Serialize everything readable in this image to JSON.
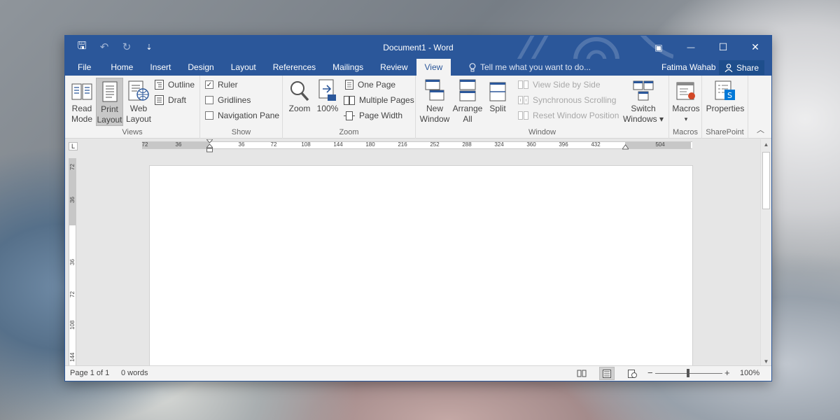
{
  "window": {
    "title": "Document1 - Word",
    "accent_color": "#2b579a",
    "quick_access": [
      {
        "name": "save",
        "icon": "save-icon",
        "glyph": "🖫"
      },
      {
        "name": "undo",
        "icon": "undo-icon",
        "glyph": "↶"
      },
      {
        "name": "redo",
        "icon": "redo-icon",
        "glyph": "↻"
      },
      {
        "name": "customize",
        "icon": "customize-qat-icon",
        "glyph": "⇣"
      }
    ],
    "controls": {
      "ribbon_options": "▣",
      "minimize": "—",
      "maximize": "☐",
      "close": "✕"
    }
  },
  "tabs": [
    "File",
    "Home",
    "Insert",
    "Design",
    "Layout",
    "References",
    "Mailings",
    "Review",
    "View"
  ],
  "active_tab": "View",
  "tell_me": "Tell me what you want to do...",
  "user": "Fatima Wahab",
  "share": "Share",
  "ribbon": {
    "views": {
      "label": "Views",
      "read_mode": [
        "Read",
        "Mode"
      ],
      "print_layout": [
        "Print",
        "Layout"
      ],
      "web_layout": [
        "Web",
        "Layout"
      ],
      "outline": "Outline",
      "draft": "Draft"
    },
    "show": {
      "label": "Show",
      "ruler": {
        "text": "Ruler",
        "checked": true
      },
      "gridlines": {
        "text": "Gridlines",
        "checked": false
      },
      "navigation_pane": {
        "text": "Navigation Pane",
        "checked": false
      }
    },
    "zoom": {
      "label": "Zoom",
      "zoom": "Zoom",
      "hundred": "100%",
      "one_page": "One Page",
      "multiple_pages": "Multiple Pages",
      "page_width": "Page Width"
    },
    "window": {
      "label": "Window",
      "new_window": [
        "New",
        "Window"
      ],
      "arrange_all": [
        "Arrange",
        "All"
      ],
      "split": "Split",
      "view_side_by_side": "View Side by Side",
      "sync_scrolling": "Synchronous Scrolling",
      "reset_position": "Reset Window Position",
      "switch_windows": [
        "Switch",
        "Windows ▾"
      ]
    },
    "macros": {
      "label": "Macros",
      "macros": "Macros",
      "arrow": "▾"
    },
    "sharepoint": {
      "label": "SharePoint",
      "properties": "Properties"
    }
  },
  "ruler": {
    "h_labels": [
      "72",
      "36",
      "36",
      "72",
      "108",
      "144",
      "180",
      "216",
      "252",
      "288",
      "324",
      "360",
      "396",
      "432",
      "504"
    ],
    "v_labels": [
      "72",
      "36",
      "36",
      "72",
      "108",
      "144"
    ]
  },
  "status": {
    "page": "Page 1 of 1",
    "words": "0 words",
    "zoom_level": "100%",
    "zoom_minus": "−",
    "zoom_plus": "+"
  }
}
